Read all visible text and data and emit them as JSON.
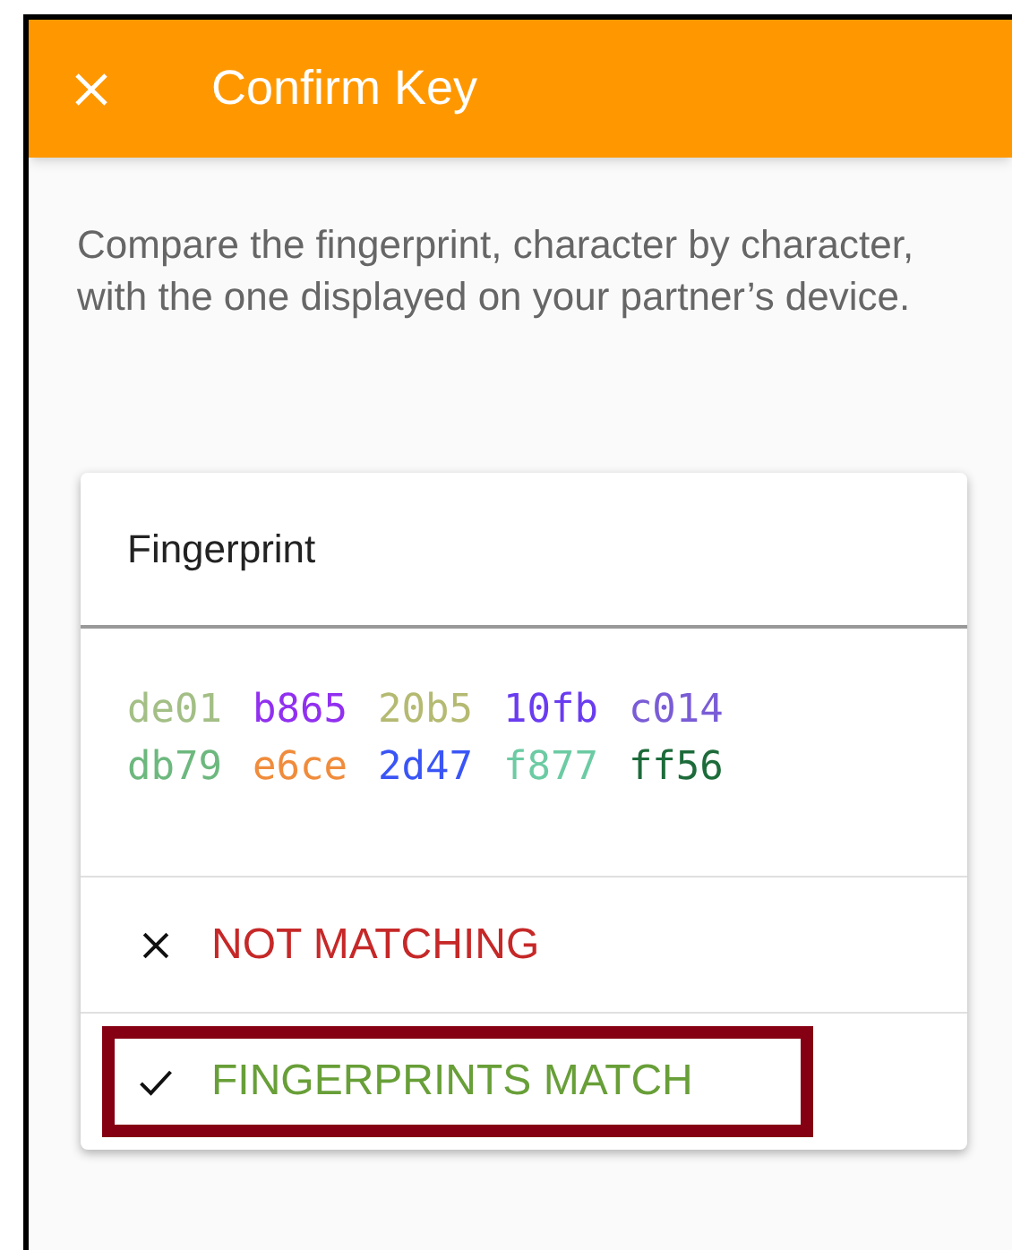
{
  "app_bar": {
    "title": "Confirm Key"
  },
  "description": "Compare the fingerprint, character by character, with the one displayed on your partner’s device.",
  "card": {
    "title": "Fingerprint",
    "fingerprint": [
      {
        "text": "de01",
        "color": "#a3bf86"
      },
      {
        "text": "b865",
        "color": "#9130f0"
      },
      {
        "text": "20b5",
        "color": "#b5ba72"
      },
      {
        "text": "10fb",
        "color": "#6a3cf0"
      },
      {
        "text": "c014",
        "color": "#7a5cd6"
      },
      {
        "text": "db79",
        "color": "#6db87e"
      },
      {
        "text": "e6ce",
        "color": "#f08c3c"
      },
      {
        "text": "2d47",
        "color": "#3a55f5"
      },
      {
        "text": "f877",
        "color": "#6ccba3"
      },
      {
        "text": "ff56",
        "color": "#1d6b3a"
      }
    ],
    "options": [
      {
        "kind": "reject",
        "label": "NOT MATCHING",
        "color": "#c62828",
        "highlighted": false
      },
      {
        "kind": "confirm",
        "label": "FINGERPRINTS MATCH",
        "color": "#689f38",
        "highlighted": true
      }
    ]
  }
}
